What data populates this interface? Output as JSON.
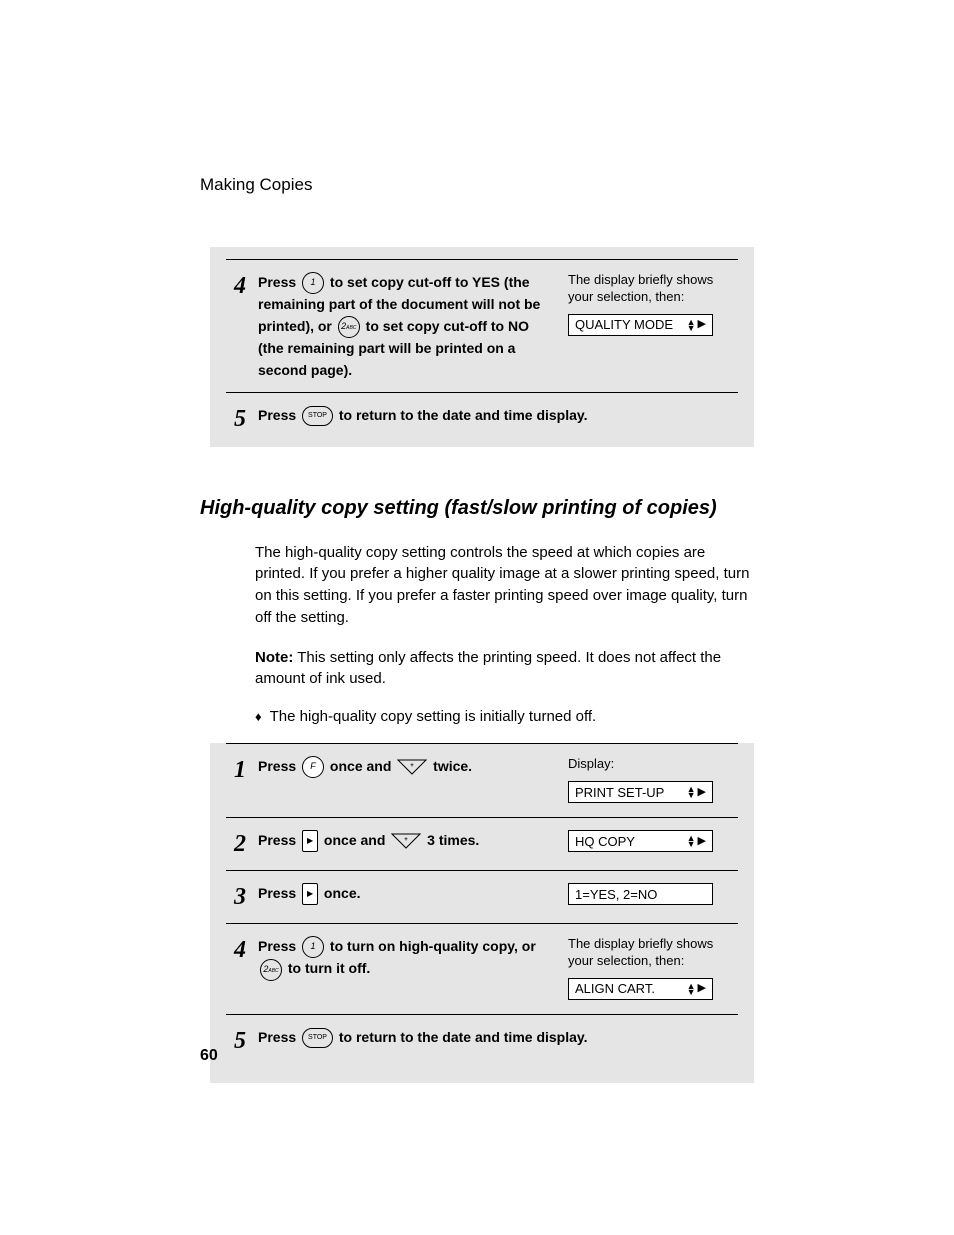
{
  "header": "Making Copies",
  "page_number": "60",
  "block1": {
    "steps": [
      {
        "num": "4",
        "text_a": "Press ",
        "key_a": "1",
        "text_b": " to set copy cut-off to YES (the remaining part of the document will not be printed), or ",
        "key_b": "2",
        "key_b_sub": "ABC",
        "text_c": " to set copy cut-off to NO (the remaining part will be printed on a second page).",
        "right_note": "The display briefly shows your selection, then:",
        "lcd": "QUALITY MODE"
      },
      {
        "num": "5",
        "text_a": "Press ",
        "key_a": "STOP",
        "text_b": " to return to the date and time display."
      }
    ]
  },
  "section_title": "High-quality copy setting (fast/slow printing of copies)",
  "para1": "The high-quality copy setting controls the speed at which copies are printed. If you prefer a higher quality image at a slower printing speed, turn on this setting. If you prefer a faster printing speed over image quality, turn off the setting.",
  "note_label": "Note:",
  "para2": " This setting only affects the printing speed. It does not affect the amount of ink used.",
  "bullet1": "The high-quality copy setting is initially turned off.",
  "block2": {
    "steps": [
      {
        "num": "1",
        "text_a": "Press ",
        "key_a": "F",
        "text_b": " once and ",
        "key_b_type": "tri",
        "text_c": " twice.",
        "right_label": "Display:",
        "lcd": "PRINT SET-UP"
      },
      {
        "num": "2",
        "text_a": "Press ",
        "key_a_type": "square",
        "text_b": " once and ",
        "key_b_type": "tri",
        "text_c": " 3 times.",
        "lcd": "HQ COPY"
      },
      {
        "num": "3",
        "text_a": "Press ",
        "key_a_type": "square",
        "text_b": " once.",
        "lcd": "1=YES, 2=NO",
        "lcd_plain": true
      },
      {
        "num": "4",
        "text_a": "Press ",
        "key_a": "1",
        "text_b": " to turn on high-quality copy, or ",
        "key_b": "2",
        "key_b_sub": "ABC",
        "text_c": " to turn it off.",
        "right_note": "The display briefly shows your selection, then:",
        "lcd": "ALIGN CART."
      },
      {
        "num": "5",
        "text_a": "Press ",
        "key_a": "STOP",
        "key_a_type": "oval",
        "text_b": " to return to the date and time display."
      }
    ]
  }
}
